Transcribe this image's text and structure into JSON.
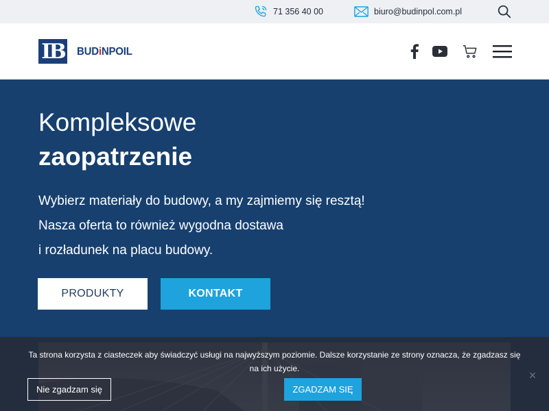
{
  "topbar": {
    "phone": "71 356 40 00",
    "email": "biuro@budinpol.com.pl",
    "phone_icon": "phone-icon",
    "email_icon": "envelope-icon",
    "search_icon": "search-icon"
  },
  "header": {
    "logo_mark": "IB",
    "logo_text_a": "BUD",
    "logo_text_dot": "i",
    "logo_text_b": "NPOIL",
    "icons": [
      "facebook-icon",
      "youtube-icon",
      "cart-icon",
      "hamburger-menu-icon"
    ]
  },
  "hero": {
    "title_line1": "Kompleksowe",
    "title_line2": "zaopatrzenie",
    "text_line1": "Wybierz materiały do budowy, a my zajmiemy się resztą!",
    "text_line2": "Nasza oferta to również wygodna dostawa",
    "text_line3": "i rozładunek na placu budowy.",
    "btn_products": "PRODUKTY",
    "btn_contact": "KONTAKT"
  },
  "cookie": {
    "message": "Ta strona korzysta z ciasteczek aby świadczyć usługi na najwyższym poziomie. Dalsze korzystanie ze strony oznacza, że zgadzasz się na ich użycie.",
    "decline": "Nie zgadzam się",
    "accept": "ZGADZAM SIĘ",
    "close": "×"
  },
  "colors": {
    "hero_bg": "#17406f",
    "accent": "#1ea3dd",
    "brand": "#1b3f7a",
    "topbar_bg": "#eef0f4"
  }
}
